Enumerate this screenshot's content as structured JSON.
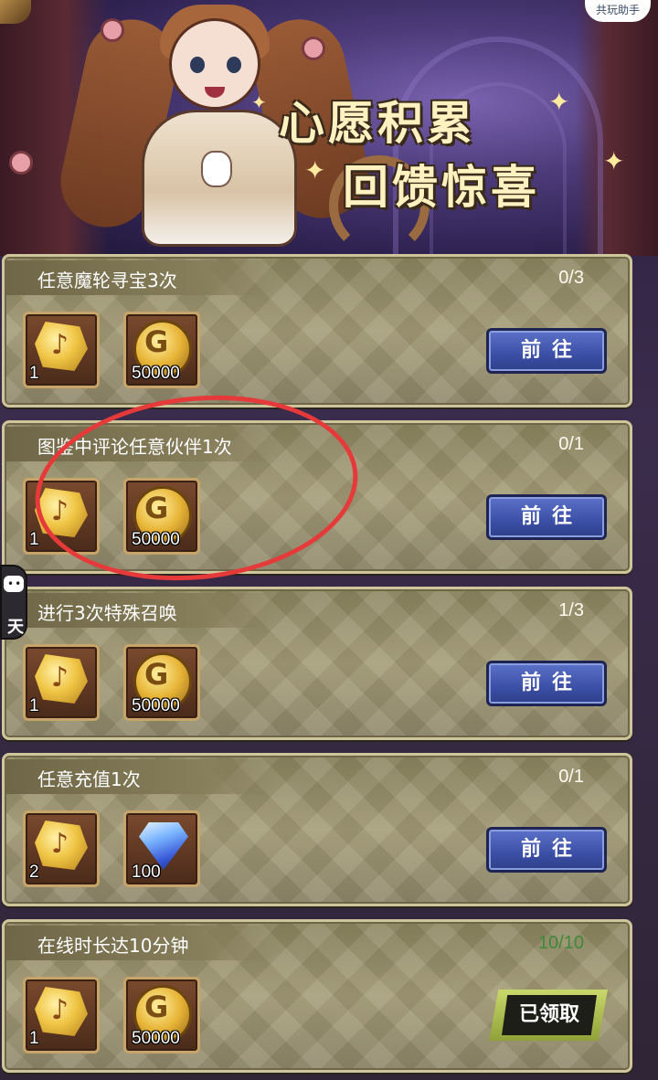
{
  "banner": {
    "title_line1": "心愿积累",
    "title_line2": "回馈惊喜",
    "helper_label": "共玩助手",
    "sparkles": [
      "✦",
      "✦",
      "✦",
      "✦"
    ]
  },
  "side_chat": {
    "label": "天",
    "icon": "chat-icon"
  },
  "tasks": [
    {
      "title": "任意魔轮寻宝3次",
      "progress": "0/3",
      "rewards": [
        {
          "type": "rune",
          "count": "1"
        },
        {
          "type": "coin",
          "count": "50000"
        }
      ],
      "action": "前往",
      "status": "in_progress"
    },
    {
      "title": "图鉴中评论任意伙伴1次",
      "progress": "0/1",
      "rewards": [
        {
          "type": "rune",
          "count": "1"
        },
        {
          "type": "coin",
          "count": "50000"
        }
      ],
      "action": "前往",
      "status": "in_progress"
    },
    {
      "title": "进行3次特殊召唤",
      "progress": "1/3",
      "rewards": [
        {
          "type": "rune",
          "count": "1"
        },
        {
          "type": "coin",
          "count": "50000"
        }
      ],
      "action": "前往",
      "status": "in_progress"
    },
    {
      "title": "任意充值1次",
      "progress": "0/1",
      "rewards": [
        {
          "type": "rune",
          "count": "2"
        },
        {
          "type": "diamond",
          "count": "100"
        }
      ],
      "action": "前往",
      "status": "in_progress"
    },
    {
      "title": "在线时长达10分钟",
      "progress": "10/10",
      "rewards": [
        {
          "type": "rune",
          "count": "1"
        },
        {
          "type": "coin",
          "count": "50000"
        }
      ],
      "action": "已领取",
      "status": "claimed"
    }
  ],
  "colors": {
    "progress_done": "#3f8a3a",
    "go_button": "#3b4fa6",
    "annotation": "#e63a3a"
  }
}
